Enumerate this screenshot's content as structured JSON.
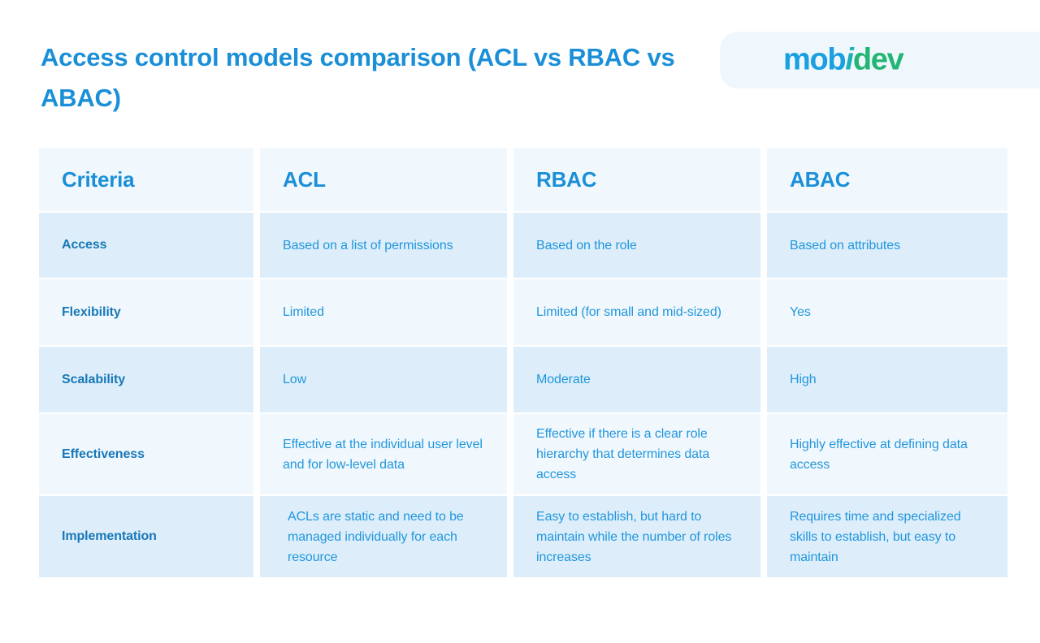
{
  "header": {
    "title": "Access control models comparison (ACL vs RBAC vs ABAC)",
    "logo": {
      "part_a": "mob",
      "part_i": "i",
      "part_b": "dev",
      "full_text": "mobidev"
    }
  },
  "colors": {
    "title_blue": "#1a8fd8",
    "header_cell_bg": "#f1f8fd",
    "row_dark_bg": "#ddeefa",
    "row_light_bg": "#f1f8fd",
    "criteria_text": "#1878b8",
    "cell_text": "#2196dd",
    "logo_blue": "#1a9fe0",
    "logo_teal": "#1bb0b6",
    "logo_green": "#22b573",
    "logo_pill_bg": "#eff7fd",
    "page_bg": "#ffffff"
  },
  "table": {
    "columns": [
      "Criteria",
      "ACL",
      "RBAC",
      "ABAC"
    ],
    "rows": [
      {
        "criteria": "Access",
        "acl": "Based on a list of permissions",
        "rbac": "Based on the role",
        "abac": "Based on attributes"
      },
      {
        "criteria": "Flexibility",
        "acl": "Limited",
        "rbac": "Limited (for small and mid-sized)",
        "abac": "Yes"
      },
      {
        "criteria": "Scalability",
        "acl": "Low",
        "rbac": "Moderate",
        "abac": "High"
      },
      {
        "criteria": "Effectiveness",
        "acl": "Effective at the individual user level and for low-level data",
        "rbac": "Effective if there is a clear role hierarchy that determines data access",
        "abac": "Highly effective at defining data access"
      },
      {
        "criteria": "Implementation",
        "acl": "ACLs are static and need to be managed individually for each resource",
        "rbac": "Easy to establish, but hard to maintain while the number of roles increases",
        "abac": "Requires time and specialized skills to establish, but easy to maintain"
      }
    ]
  }
}
